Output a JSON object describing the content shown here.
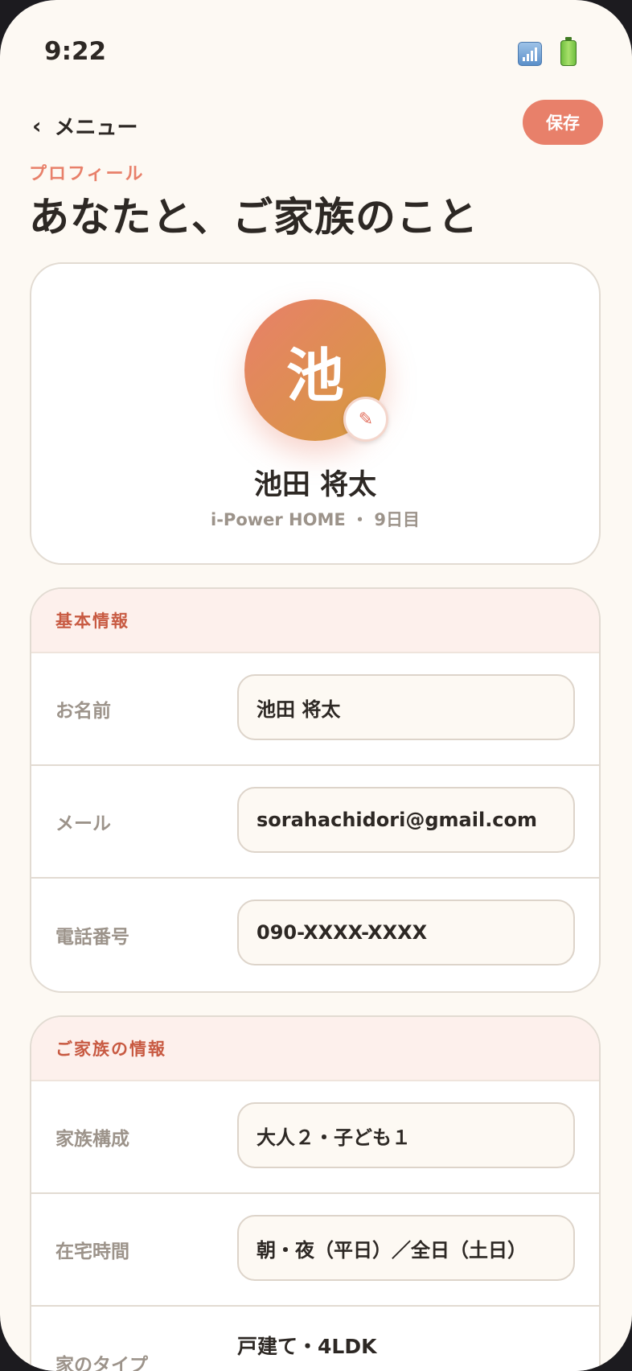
{
  "status_bar": {
    "time": "9:22",
    "signal_icon": "signal-icon",
    "battery_icon": "battery-icon"
  },
  "nav": {
    "back_label": "メニュー",
    "back_icon": "chevron-left-icon",
    "save_label": "保存"
  },
  "header": {
    "eyebrow": "プロフィール",
    "title": "あなたと、ご家族のこと"
  },
  "profile": {
    "avatar_letter": "池",
    "edit_icon": "pencil-icon",
    "name": "池田 将太",
    "meta": "i-Power HOME ・ 9日目"
  },
  "basic_info": {
    "title": "基本情報",
    "fields": [
      {
        "label": "お名前",
        "value": "池田 将太"
      },
      {
        "label": "メール",
        "value": "sorahachidori@gmail.com"
      },
      {
        "label": "電話番号",
        "value": "090-XXXX-XXXX"
      }
    ]
  },
  "family_info": {
    "title": "ご家族の情報",
    "fields": [
      {
        "label": "家族構成",
        "value": "大人２・子ども１"
      },
      {
        "label": "在宅時間",
        "value": "朝・夜（平日）／全日（土日）"
      },
      {
        "label": "家のタイプ",
        "value": "戸建て・4LDK"
      }
    ]
  },
  "colors": {
    "accent": "#e8806a",
    "background": "#fdf9f3",
    "section_title": "#c85a42"
  }
}
